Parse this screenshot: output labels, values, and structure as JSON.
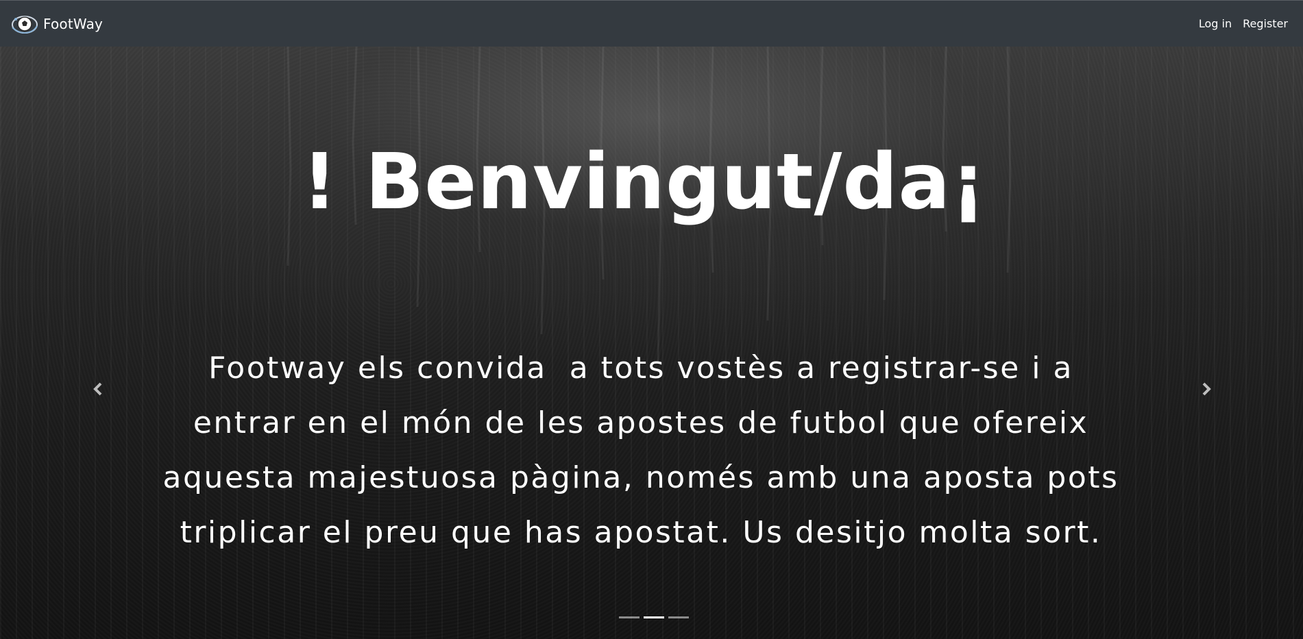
{
  "navbar": {
    "brand": "FootWay",
    "links": {
      "login": "Log in",
      "register": "Register"
    }
  },
  "hero": {
    "title": "! Benvingut/da¡",
    "text": "Footway els convida  a tots vostès a registrar-se i a entrar en el món de les apostes de futbol que ofereix aquesta majestuosa pàgina, només amb una aposta pots triplicar el preu que has apostat. Us desitjo molta sort.",
    "slides_total": 3,
    "active_slide": 2
  },
  "icons": {
    "brand": "football-logo-icon",
    "prev": "chevron-left-icon",
    "next": "chevron-right-icon"
  },
  "colors": {
    "navbar": "#343a40",
    "text": "#ffffff"
  }
}
